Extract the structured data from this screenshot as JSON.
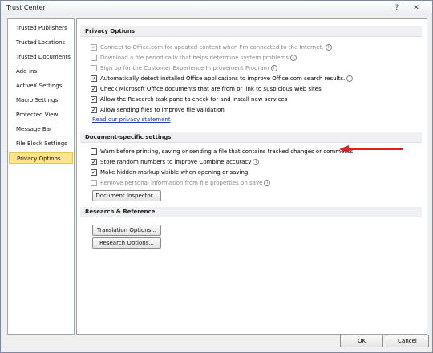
{
  "window": {
    "title": "Trust Center",
    "help": "?",
    "close": "✕"
  },
  "sidebar": {
    "items": [
      {
        "label": "Trusted Publishers",
        "active": false
      },
      {
        "label": "Trusted Locations",
        "active": false
      },
      {
        "label": "Trusted Documents",
        "active": false
      },
      {
        "label": "Add-ins",
        "active": false
      },
      {
        "label": "ActiveX Settings",
        "active": false
      },
      {
        "label": "Macro Settings",
        "active": false
      },
      {
        "label": "Protected View",
        "active": false
      },
      {
        "label": "Message Bar",
        "active": false
      },
      {
        "label": "File Block Settings",
        "active": false
      },
      {
        "label": "Privacy Options",
        "active": true
      }
    ]
  },
  "privacy": {
    "header": "Privacy Options",
    "options": [
      {
        "label": "Connect to Office.com for updated content when I'm connected to the Internet.",
        "checked": true,
        "disabled": true,
        "info": true
      },
      {
        "label": "Download a file periodically that helps determine system problems",
        "checked": false,
        "disabled": true,
        "info": true
      },
      {
        "label": "Sign up for the Customer Experience Improvement Program",
        "checked": false,
        "disabled": true,
        "info": true
      },
      {
        "label": "Automatically detect installed Office applications to improve Office.com search results.",
        "checked": true,
        "disabled": false,
        "info": true
      },
      {
        "label": "Check Microsoft Office documents that are from or link to suspicious Web sites",
        "checked": true,
        "disabled": false,
        "info": false
      },
      {
        "label": "Allow the Research task pane to check for and install new services",
        "checked": true,
        "disabled": false,
        "info": false
      },
      {
        "label": "Allow sending files to improve file validation",
        "checked": true,
        "disabled": false,
        "info": false
      }
    ],
    "link": "Read our privacy statement"
  },
  "document": {
    "header": "Document-specific settings",
    "options": [
      {
        "label": "Warn before printing, saving or sending a file that contains tracked changes or comments",
        "checked": false,
        "disabled": false,
        "info": false
      },
      {
        "label": "Store random numbers to improve Combine accuracy",
        "checked": true,
        "disabled": false,
        "info": true
      },
      {
        "label": "Make hidden markup visible when opening or saving",
        "checked": true,
        "disabled": false,
        "info": false
      },
      {
        "label": "Remove personal information from file properties on save",
        "checked": false,
        "disabled": true,
        "info": true
      }
    ],
    "button": "Document Inspector..."
  },
  "research": {
    "header": "Research & Reference",
    "translation_button": "Translation Options...",
    "research_button": "Research Options..."
  },
  "footer": {
    "ok": "OK",
    "cancel": "Cancel"
  },
  "colors": {
    "arrow": "#e02020",
    "active_item": "#fde48d",
    "link": "#1a3fa8"
  }
}
